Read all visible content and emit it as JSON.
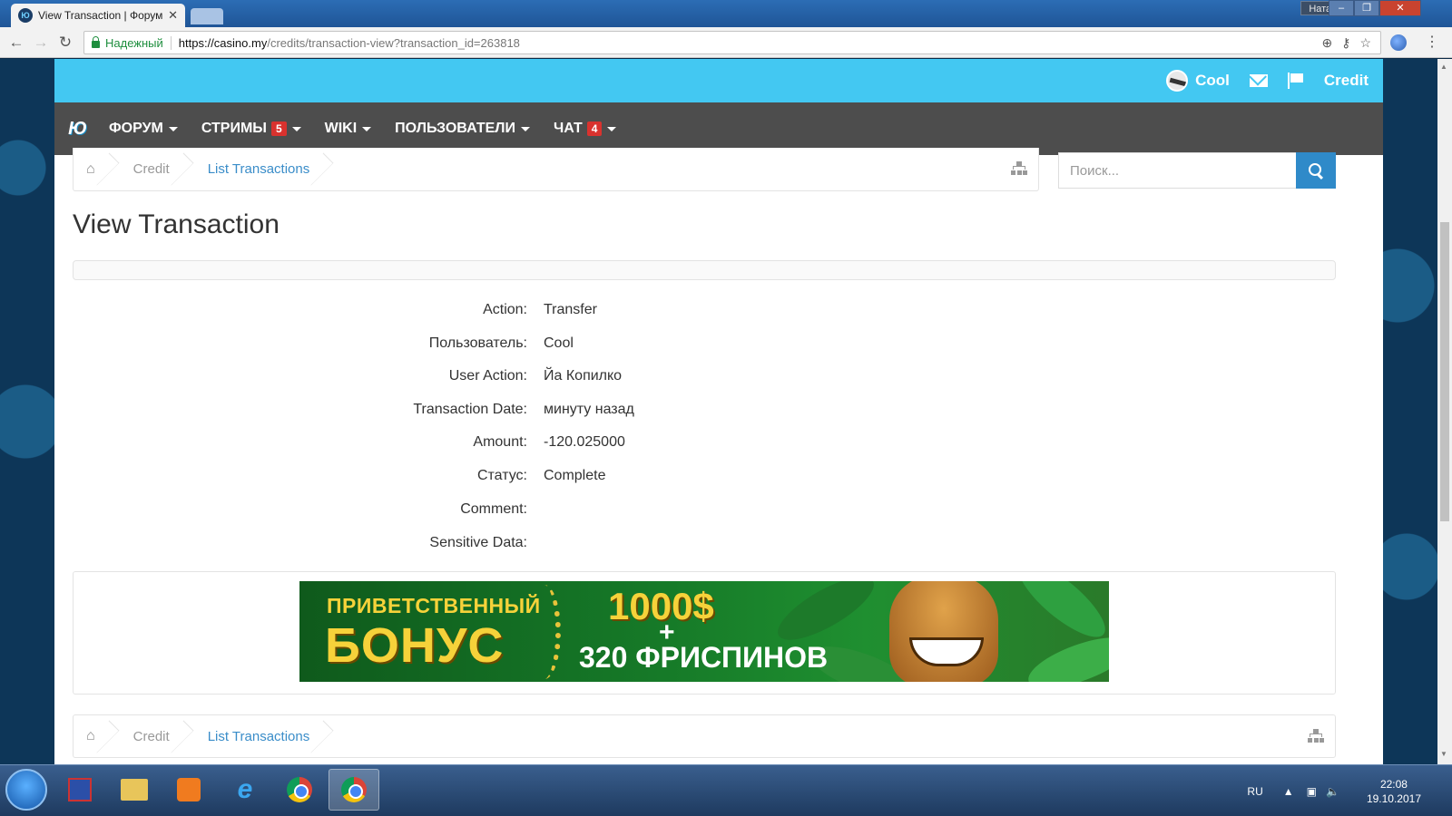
{
  "browser": {
    "tab_title": "View Transaction | Форум",
    "favicon_text": "Ю",
    "win_user": "Наталия",
    "security_label": "Надежный",
    "url_host": "https://casino.my",
    "url_rest": "/credits/transaction-view?transaction_id=263818"
  },
  "topbar": {
    "username": "Cool",
    "credit_link": "Credit"
  },
  "nav": {
    "logo_text": "Ю",
    "items": [
      {
        "label": "ФОРУМ",
        "badge": ""
      },
      {
        "label": "СТРИМЫ",
        "badge": "5"
      },
      {
        "label": "WIKI",
        "badge": ""
      },
      {
        "label": "ПОЛЬЗОВАТЕЛИ",
        "badge": ""
      },
      {
        "label": "ЧАТ",
        "badge": "4"
      }
    ]
  },
  "breadcrumb": {
    "home_icon": "home-icon",
    "items": [
      "Credit",
      "List Transactions"
    ]
  },
  "search": {
    "placeholder": "Поиск..."
  },
  "page": {
    "title": "View Transaction"
  },
  "details": [
    {
      "label": "Action:",
      "value": "Transfer"
    },
    {
      "label": "Пользователь:",
      "value": "Cool"
    },
    {
      "label": "User Action:",
      "value": "Йа Копилко"
    },
    {
      "label": "Transaction Date:",
      "value": "минуту назад"
    },
    {
      "label": "Amount:",
      "value": "-120.025000"
    },
    {
      "label": "Статус:",
      "value": "Complete"
    },
    {
      "label": "Comment:",
      "value": ""
    },
    {
      "label": "Sensitive Data:",
      "value": ""
    }
  ],
  "banner": {
    "line1": "ПРИВЕТСТВЕННЫЙ",
    "line2": "БОНУС",
    "amount": "1000$",
    "plus": "+",
    "spins": "320 ФРИСПИНОВ"
  },
  "taskbar": {
    "lang": "RU",
    "time": "22:08",
    "date": "19.10.2017"
  },
  "colors": {
    "topbar": "#43c8f2",
    "nav": "#4d4d4d",
    "link": "#3a8dc9",
    "badge": "#d9322e"
  }
}
